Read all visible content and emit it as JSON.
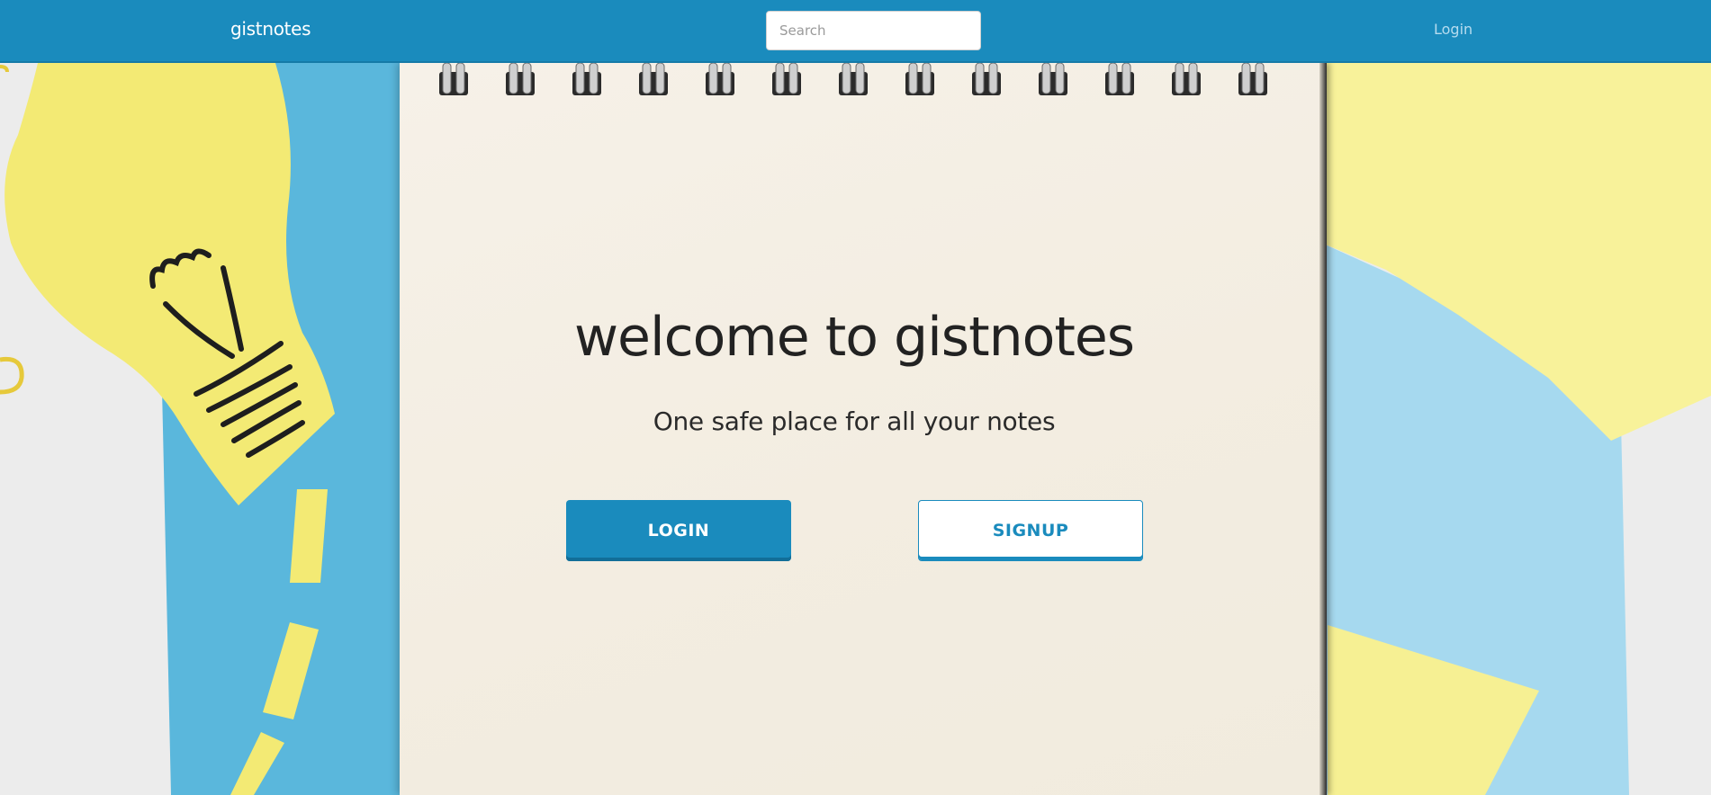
{
  "navbar": {
    "brand": "gistnotes",
    "search_placeholder": "Search",
    "login_link": "Login"
  },
  "hero": {
    "title": "welcome to gistnotes",
    "subtitle": "One safe place for all your notes",
    "login_button": "LOGIN",
    "signup_button": "SIGNUP"
  },
  "colors": {
    "primary": "#1a8bbd",
    "background_blue": "#5ab7dc",
    "sticky_yellow": "#f3ea74",
    "paper": "#f4efe4"
  }
}
